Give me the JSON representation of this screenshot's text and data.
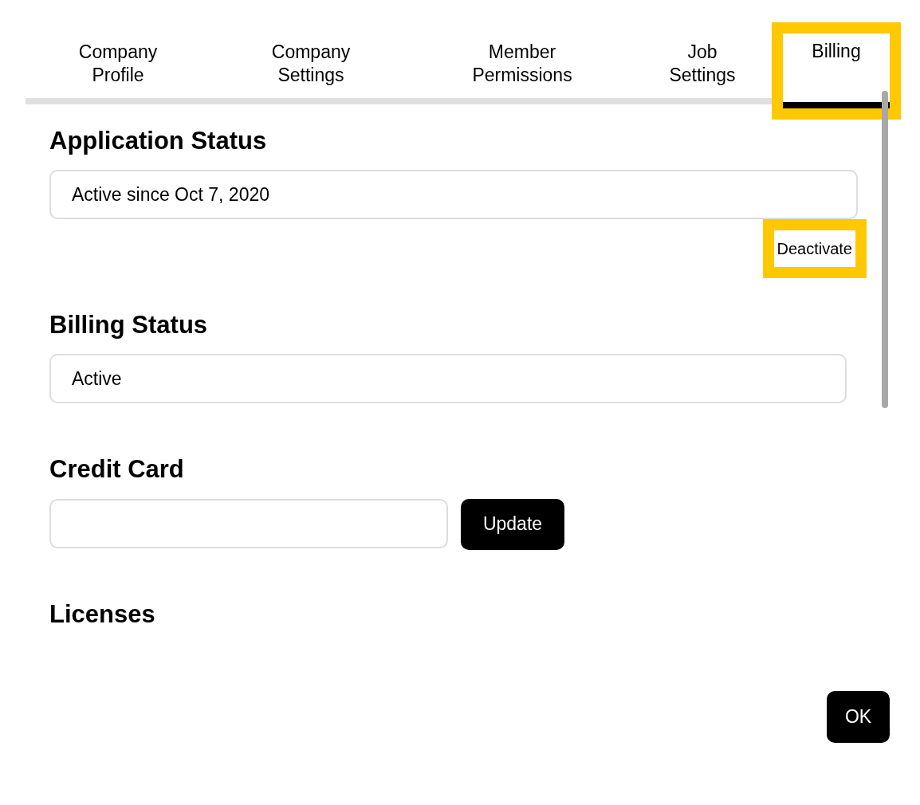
{
  "tabs": [
    {
      "label": "Company Profile",
      "selected": false,
      "highlighted": false
    },
    {
      "label": "Company Settings",
      "selected": false,
      "highlighted": false
    },
    {
      "label": "Member Permissions",
      "selected": false,
      "highlighted": false
    },
    {
      "label": "Job Settings",
      "selected": false,
      "highlighted": false
    },
    {
      "label": "Billing",
      "selected": true,
      "highlighted": true
    }
  ],
  "sections": [
    {
      "heading": "Application Status",
      "kind": "status",
      "value": "Active since Oct 7, 2020",
      "button": {
        "label": "Deactivate",
        "highlighted": true
      }
    },
    {
      "heading": "Billing Status",
      "kind": "status",
      "value": "Active"
    },
    {
      "heading": "Credit Card",
      "kind": "card",
      "button": {
        "label": "Update"
      }
    },
    {
      "heading": "Licenses",
      "kind": "heading"
    }
  ],
  "ok_button": "OK"
}
